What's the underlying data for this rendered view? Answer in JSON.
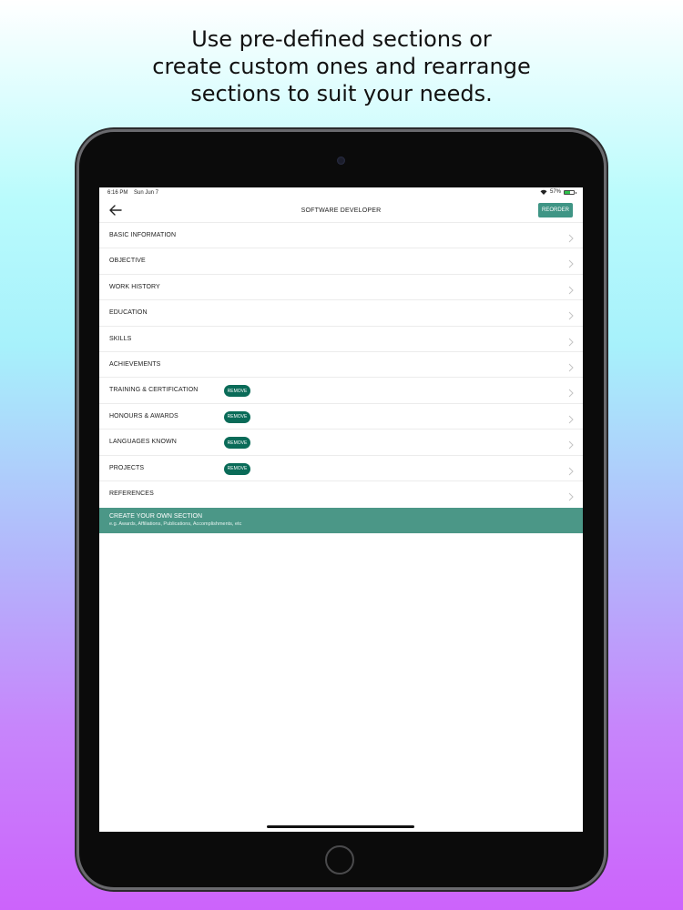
{
  "headline": "Use pre-defined sections or\ncreate custom ones and rearrange\nsections to suit your needs.",
  "status_bar": {
    "time": "6:16 PM",
    "date": "Sun Jun 7",
    "battery": "57%",
    "battery_level": 0.57
  },
  "nav": {
    "title": "SOFTWARE DEVELOPER",
    "reorder_label": "REORDER",
    "back_icon": "arrow-left-icon"
  },
  "sections": [
    {
      "label": "BASIC INFORMATION",
      "removable": false
    },
    {
      "label": "OBJECTIVE",
      "removable": false
    },
    {
      "label": "WORK HISTORY",
      "removable": false
    },
    {
      "label": "EDUCATION",
      "removable": false
    },
    {
      "label": "SKILLS",
      "removable": false
    },
    {
      "label": "ACHIEVEMENTS",
      "removable": false
    },
    {
      "label": "TRAINING & CERTIFICATION",
      "removable": true
    },
    {
      "label": "HONOURS & AWARDS",
      "removable": true
    },
    {
      "label": "LANGUAGES KNOWN",
      "removable": true
    },
    {
      "label": "PROJECTS",
      "removable": true
    },
    {
      "label": "REFERENCES",
      "removable": false
    }
  ],
  "remove_label": "REMOVE",
  "create_section": {
    "title": "CREATE YOUR OWN SECTION",
    "subtitle": "e.g. Awards, Affiliations, Publications, Accomplishments, etc"
  },
  "colors": {
    "accent": "#3f9585",
    "remove": "#0a6b58",
    "create_bar": "#4b9787"
  }
}
